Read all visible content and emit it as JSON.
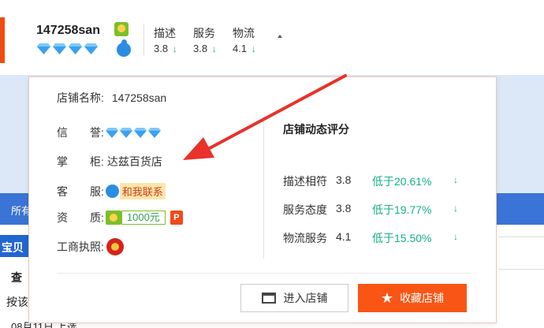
{
  "header": {
    "shop_name": "147258san",
    "ratings": [
      {
        "label": "描述",
        "score": "3.8",
        "arrow": "↓"
      },
      {
        "label": "服务",
        "score": "3.8",
        "arrow": "↓"
      },
      {
        "label": "物流",
        "score": "4.1",
        "arrow": "↓"
      }
    ]
  },
  "background": {
    "nav_text": "所有",
    "row1": "宝贝",
    "row2": "查",
    "row3": "按该",
    "row4": "08月11日 上选"
  },
  "popup": {
    "shop_name_label": "店铺名称:",
    "shop_name_value": "147258san",
    "credit_label": "信　　誉:",
    "owner_label": "掌　　柜:",
    "owner_value": "达兹百货店",
    "service_label": "客　　服:",
    "contact_text": "和我联系",
    "qualification_label": "资　　质:",
    "deposit_amount": "1000元",
    "deposit_badge": "P",
    "license_label": "工商执照:",
    "dynamic_title": "店铺动态评分",
    "dynamic_rows": [
      {
        "name": "描述相符",
        "score": "3.8",
        "compare": "低于20.61%",
        "arrow": "↓"
      },
      {
        "name": "服务态度",
        "score": "3.8",
        "compare": "低于19.77%",
        "arrow": "↓"
      },
      {
        "name": "物流服务",
        "score": "4.1",
        "compare": "低于15.50%",
        "arrow": "↓"
      }
    ],
    "enter_shop_label": "进入店铺",
    "favorite_shop_label": "收藏店铺"
  },
  "icons": {
    "diamond": "diamond-icon",
    "wangwang": "wangwang-icon",
    "deposit": "deposit-icon",
    "license": "business-license-icon",
    "shop": "shop-icon",
    "star": "star-icon"
  },
  "colors": {
    "accent_orange": "#f95616",
    "down_green": "#16b087",
    "diamond_blue": "#2b8ce3",
    "annotation_red": "#e8322a"
  }
}
